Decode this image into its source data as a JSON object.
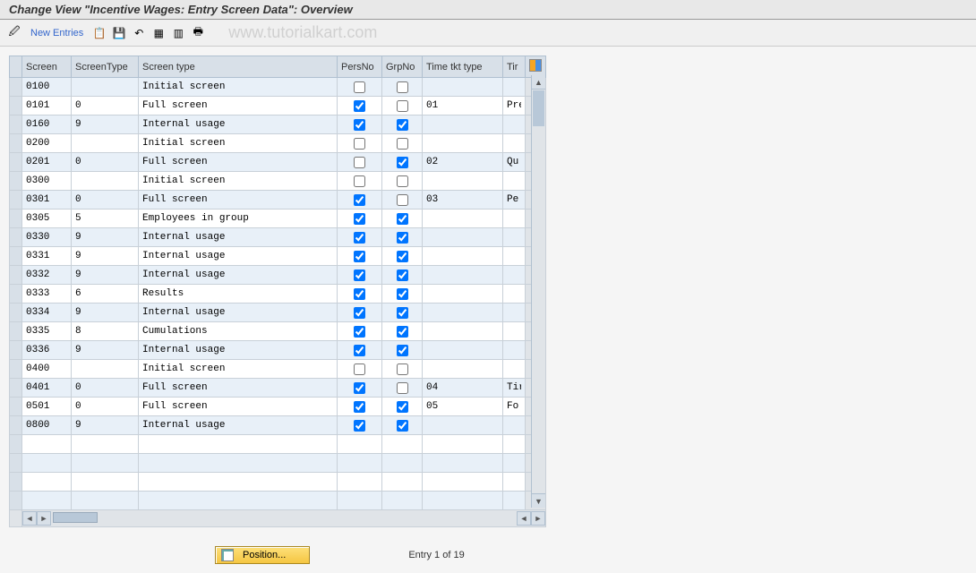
{
  "title": "Change View \"Incentive Wages: Entry Screen Data\": Overview",
  "toolbar": {
    "new_entries": "New Entries"
  },
  "watermark": "www.tutorialkart.com",
  "columns": {
    "screen": "Screen",
    "screentype": "ScreenType",
    "screentype_name": "Screen type",
    "persno": "PersNo",
    "grpno": "GrpNo",
    "timetkt": "Time tkt type",
    "trunc": "Tir"
  },
  "rows": [
    {
      "screen": "0100",
      "st": "",
      "stname": "Initial screen",
      "pers": false,
      "grp": false,
      "ttt": "",
      "trunc": ""
    },
    {
      "screen": "0101",
      "st": "0",
      "stname": "Full screen",
      "pers": true,
      "grp": false,
      "ttt": "01",
      "trunc": "Pre"
    },
    {
      "screen": "0160",
      "st": "9",
      "stname": "Internal usage",
      "pers": true,
      "grp": true,
      "ttt": "",
      "trunc": ""
    },
    {
      "screen": "0200",
      "st": "",
      "stname": "Initial screen",
      "pers": false,
      "grp": false,
      "ttt": "",
      "trunc": ""
    },
    {
      "screen": "0201",
      "st": "0",
      "stname": "Full screen",
      "pers": false,
      "grp": true,
      "ttt": "02",
      "trunc": "Qu"
    },
    {
      "screen": "0300",
      "st": "",
      "stname": "Initial screen",
      "pers": false,
      "grp": false,
      "ttt": "",
      "trunc": ""
    },
    {
      "screen": "0301",
      "st": "0",
      "stname": "Full screen",
      "pers": true,
      "grp": false,
      "ttt": "03",
      "trunc": "Pe"
    },
    {
      "screen": "0305",
      "st": "5",
      "stname": "Employees in group",
      "pers": true,
      "grp": true,
      "ttt": "",
      "trunc": ""
    },
    {
      "screen": "0330",
      "st": "9",
      "stname": "Internal usage",
      "pers": true,
      "grp": true,
      "ttt": "",
      "trunc": ""
    },
    {
      "screen": "0331",
      "st": "9",
      "stname": "Internal usage",
      "pers": true,
      "grp": true,
      "ttt": "",
      "trunc": ""
    },
    {
      "screen": "0332",
      "st": "9",
      "stname": "Internal usage",
      "pers": true,
      "grp": true,
      "ttt": "",
      "trunc": ""
    },
    {
      "screen": "0333",
      "st": "6",
      "stname": "Results",
      "pers": true,
      "grp": true,
      "ttt": "",
      "trunc": ""
    },
    {
      "screen": "0334",
      "st": "9",
      "stname": "Internal usage",
      "pers": true,
      "grp": true,
      "ttt": "",
      "trunc": ""
    },
    {
      "screen": "0335",
      "st": "8",
      "stname": "Cumulations",
      "pers": true,
      "grp": true,
      "ttt": "",
      "trunc": ""
    },
    {
      "screen": "0336",
      "st": "9",
      "stname": "Internal usage",
      "pers": true,
      "grp": true,
      "ttt": "",
      "trunc": ""
    },
    {
      "screen": "0400",
      "st": "",
      "stname": "Initial screen",
      "pers": false,
      "grp": false,
      "ttt": "",
      "trunc": ""
    },
    {
      "screen": "0401",
      "st": "0",
      "stname": "Full screen",
      "pers": true,
      "grp": false,
      "ttt": "04",
      "trunc": "Tir"
    },
    {
      "screen": "0501",
      "st": "0",
      "stname": "Full screen",
      "pers": true,
      "grp": true,
      "ttt": "05",
      "trunc": "Fo"
    },
    {
      "screen": "0800",
      "st": "9",
      "stname": "Internal usage",
      "pers": true,
      "grp": true,
      "ttt": "",
      "trunc": ""
    }
  ],
  "footer": {
    "position_label": "Position...",
    "entry_text": "Entry 1 of 19"
  }
}
